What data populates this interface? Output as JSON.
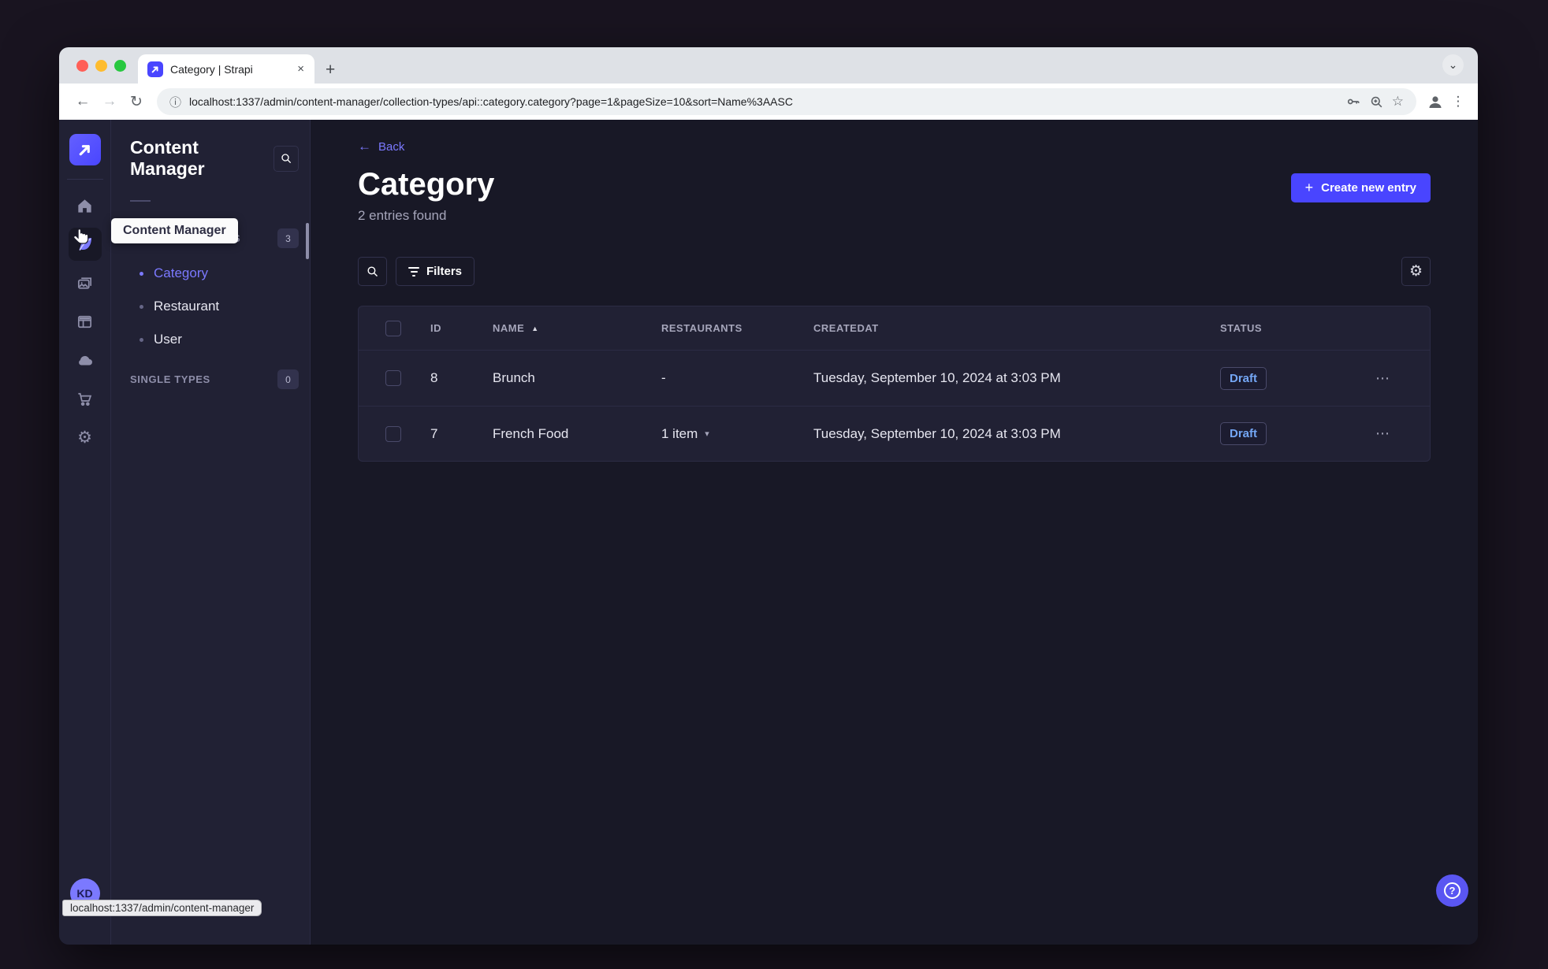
{
  "browser": {
    "tab_title": "Category | Strapi",
    "url": "localhost:1337/admin/content-manager/collection-types/api::category.category?page=1&pageSize=10&sort=Name%3AASC",
    "status_bubble": "localhost:1337/admin/content-manager"
  },
  "glyphs": {
    "back": "←",
    "forward": "→",
    "reload": "↻",
    "info": "ⓘ",
    "star": "☆",
    "menu_dots": "⋮",
    "tab_chevron": "⌄",
    "tab_close": "×",
    "new_tab": "+",
    "sort_asc": "▲",
    "item_chevron": "▾",
    "more": "⋯",
    "gear": "⚙",
    "help": "?",
    "create_plus": "+"
  },
  "rail": {
    "avatar_initials": "KD",
    "icons": [
      "home",
      "content-manager",
      "media-library",
      "content-type-builder",
      "cloud",
      "marketplace",
      "settings"
    ],
    "active_icon": "content-manager"
  },
  "sidebar": {
    "title": "Content Manager",
    "collection_types_label": "COLLECTION TYPES",
    "collection_types_count": "3",
    "items": [
      {
        "label": "Category",
        "active": true
      },
      {
        "label": "Restaurant",
        "active": false
      },
      {
        "label": "User",
        "active": false
      }
    ],
    "single_types_label": "SINGLE TYPES",
    "single_types_count": "0"
  },
  "tooltip": {
    "text": "Content Manager"
  },
  "main": {
    "back_label": "Back",
    "title": "Category",
    "subtitle": "2 entries found",
    "create_button_label": "Create new entry",
    "filters_label": "Filters",
    "table": {
      "headers": {
        "id": "ID",
        "name": "NAME",
        "restaurants": "RESTAURANTS",
        "createdat": "CREATEDAT",
        "status": "STATUS"
      },
      "rows": [
        {
          "id": "8",
          "name": "Brunch",
          "restaurants": "-",
          "createdat": "Tuesday, September 10, 2024 at 3:03 PM",
          "status": "Draft"
        },
        {
          "id": "7",
          "name": "French Food",
          "restaurants": "1 item",
          "createdat": "Tuesday, September 10, 2024 at 3:03 PM",
          "status": "Draft"
        }
      ]
    }
  },
  "colors": {
    "primary": "#4945ff",
    "primary_light": "#7b79ff",
    "app_bg": "#181826",
    "surface": "#212134",
    "border": "#32324d",
    "muted_text": "#a5a5ba",
    "draft_text": "#74a7f5"
  }
}
